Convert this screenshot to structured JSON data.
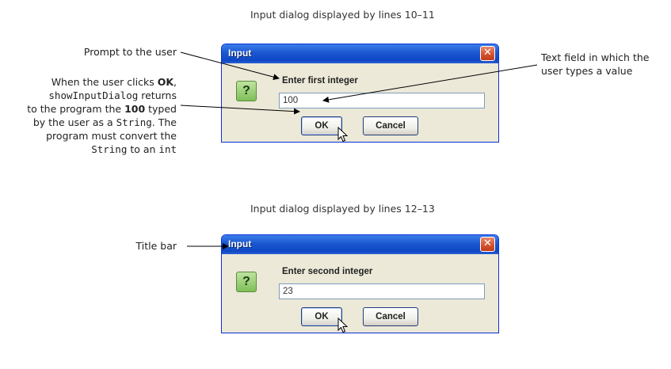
{
  "captions": {
    "top": "Input dialog displayed by lines 10–11",
    "bottom": "Input dialog displayed by lines 12–13"
  },
  "annotations": {
    "prompt_to_user": "Prompt to the user",
    "text_field_1": "Text field in which the",
    "text_field_2": "user types a value",
    "title_bar": "Title bar",
    "ok_explanation": {
      "l1_a": "When the user clicks ",
      "l1_b": "OK",
      "l1_c": ",",
      "l2_a": "showInputDialog",
      "l2_b": " returns",
      "l3_a": "to the program the ",
      "l3_b": "100",
      "l3_c": " typed",
      "l4_a": "by the user as a ",
      "l4_b": "String",
      "l4_c": ". The",
      "l5": "program must convert the",
      "l6_a": "String",
      "l6_b": " to an ",
      "l6_c": "int"
    }
  },
  "dialog1": {
    "title": "Input",
    "close_glyph": "✕",
    "icon_glyph": "?",
    "prompt": "Enter first integer",
    "field_value": "100",
    "ok_label": "OK",
    "cancel_label": "Cancel"
  },
  "dialog2": {
    "title": "Input",
    "close_glyph": "✕",
    "icon_glyph": "?",
    "prompt": "Enter second integer",
    "field_value": "23",
    "ok_label": "OK",
    "cancel_label": "Cancel"
  },
  "icons": [
    "question-icon",
    "close-icon",
    "mouse-cursor-icon"
  ],
  "colors": {
    "titlebar": "#1b57d0",
    "close": "#d4502c",
    "dialog_bg": "#ece9d8"
  }
}
